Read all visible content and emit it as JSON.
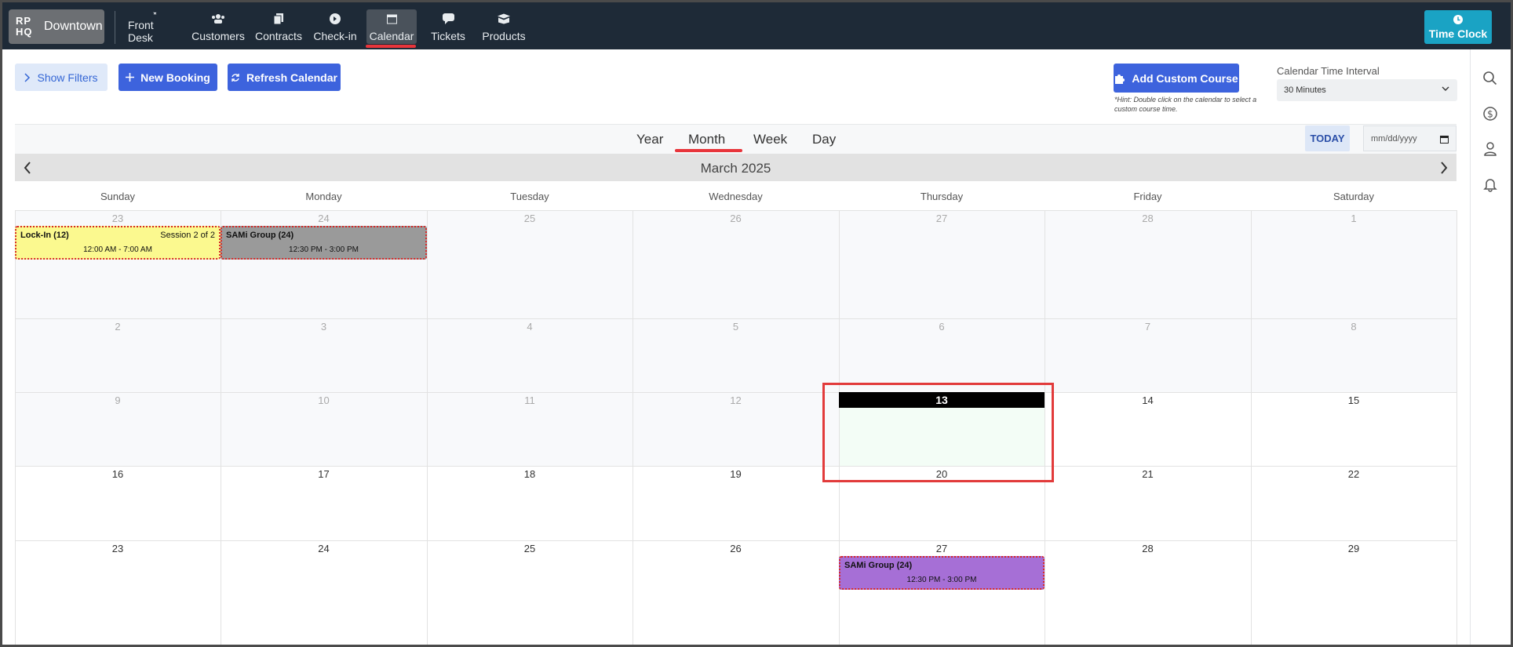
{
  "brand": {
    "logo": "RP HQ",
    "location": "Downtown"
  },
  "nav": {
    "items": [
      {
        "label": "Front Desk",
        "icon": "cart-icon"
      },
      {
        "label": "Customers",
        "icon": "users-icon"
      },
      {
        "label": "Contracts",
        "icon": "documents-icon"
      },
      {
        "label": "Check-in",
        "icon": "arrow-circle-icon"
      },
      {
        "label": "Calendar",
        "icon": "calendar-icon",
        "active": true
      },
      {
        "label": "Tickets",
        "icon": "chat-icon"
      },
      {
        "label": "Products",
        "icon": "box-icon"
      }
    ],
    "time_clock": "Time Clock"
  },
  "toolbar": {
    "show_filters": "Show Filters",
    "new_booking": "New Booking",
    "refresh_calendar": "Refresh Calendar",
    "add_custom_course": "Add Custom Course",
    "hint": "*Hint: Double click on the calendar to select a custom course time.",
    "interval_label": "Calendar Time Interval",
    "interval_value": "30 Minutes"
  },
  "views": {
    "tabs": [
      "Year",
      "Month",
      "Week",
      "Day"
    ],
    "active": "Month",
    "today_button": "TODAY",
    "date_placeholder": "mm/dd/yyyy"
  },
  "calendar": {
    "month_title": "March 2025",
    "weekdays": [
      "Sunday",
      "Monday",
      "Tuesday",
      "Wednesday",
      "Thursday",
      "Friday",
      "Saturday"
    ],
    "weeks": [
      [
        "23",
        "24",
        "25",
        "26",
        "27",
        "28",
        "1"
      ],
      [
        "2",
        "3",
        "4",
        "5",
        "6",
        "7",
        "8"
      ],
      [
        "9",
        "10",
        "11",
        "12",
        "13",
        "14",
        "15"
      ],
      [
        "16",
        "17",
        "18",
        "19",
        "20",
        "21",
        "22"
      ],
      [
        "23",
        "24",
        "25",
        "26",
        "27",
        "28",
        "29"
      ]
    ],
    "today": "13",
    "events": [
      {
        "title": "Lock-In (12)",
        "extra": "Session 2 of 2",
        "time": "12:00 AM - 7:00 AM",
        "color": "#fbf98f"
      },
      {
        "title": "SAMi Group (24)",
        "extra": "",
        "time": "12:30 PM - 3:00 PM",
        "color": "#9a9a9a"
      },
      {
        "title": "SAMi Group (24)",
        "extra": "",
        "time": "12:30 PM - 3:00 PM",
        "color": "#a66fd6"
      }
    ]
  },
  "colors": {
    "nav_bg": "#1e2a37",
    "accent": "#3d63dd",
    "time_clock": "#1aa3c4",
    "highlight": "#e23b3b"
  }
}
